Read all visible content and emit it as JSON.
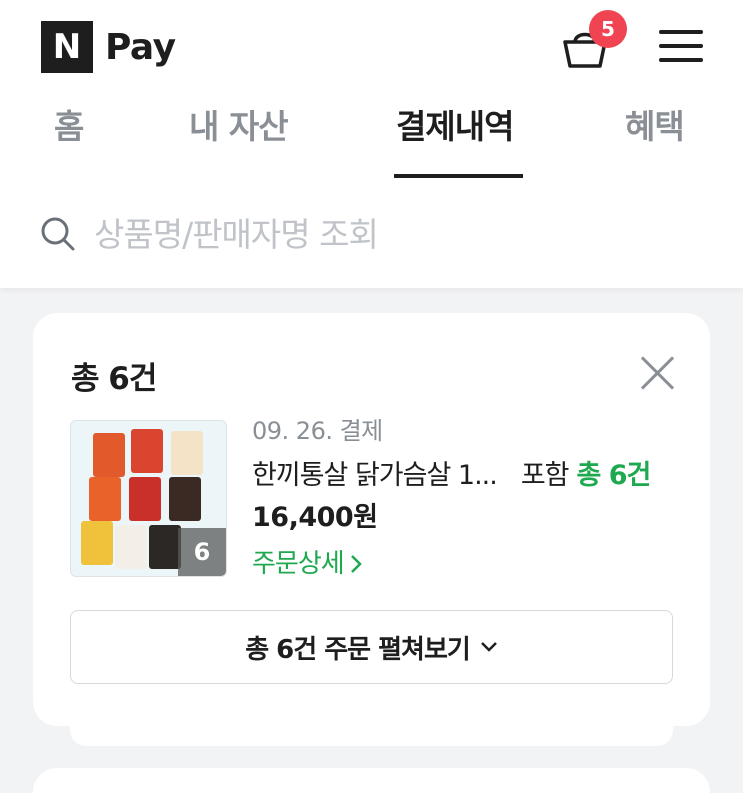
{
  "header": {
    "logo_mark": "N",
    "logo_text": "Pay",
    "cart_badge": "5",
    "cart_icon": "shopping-basket-icon",
    "menu_icon": "hamburger-menu-icon"
  },
  "tabs": [
    {
      "label": "홈",
      "active": false
    },
    {
      "label": "내 자산",
      "active": false
    },
    {
      "label": "결제내역",
      "active": true
    },
    {
      "label": "혜택",
      "active": false
    }
  ],
  "search": {
    "placeholder": "상품명/판매자명 조회",
    "value": ""
  },
  "order_card": {
    "title": "총 6건",
    "date": "09. 26. 결제",
    "product_name": "한끼통살 닭가슴살 1...",
    "included_label": "포함",
    "included_count": "총 6건",
    "price": "16,400원",
    "detail_link": "주문상세",
    "thumbnail_count": "6",
    "expand_button": "총 6건 주문 펼쳐보기"
  },
  "colors": {
    "accent_green": "#1ea84f",
    "badge_red": "#f04452",
    "background": "#f2f3f5"
  }
}
